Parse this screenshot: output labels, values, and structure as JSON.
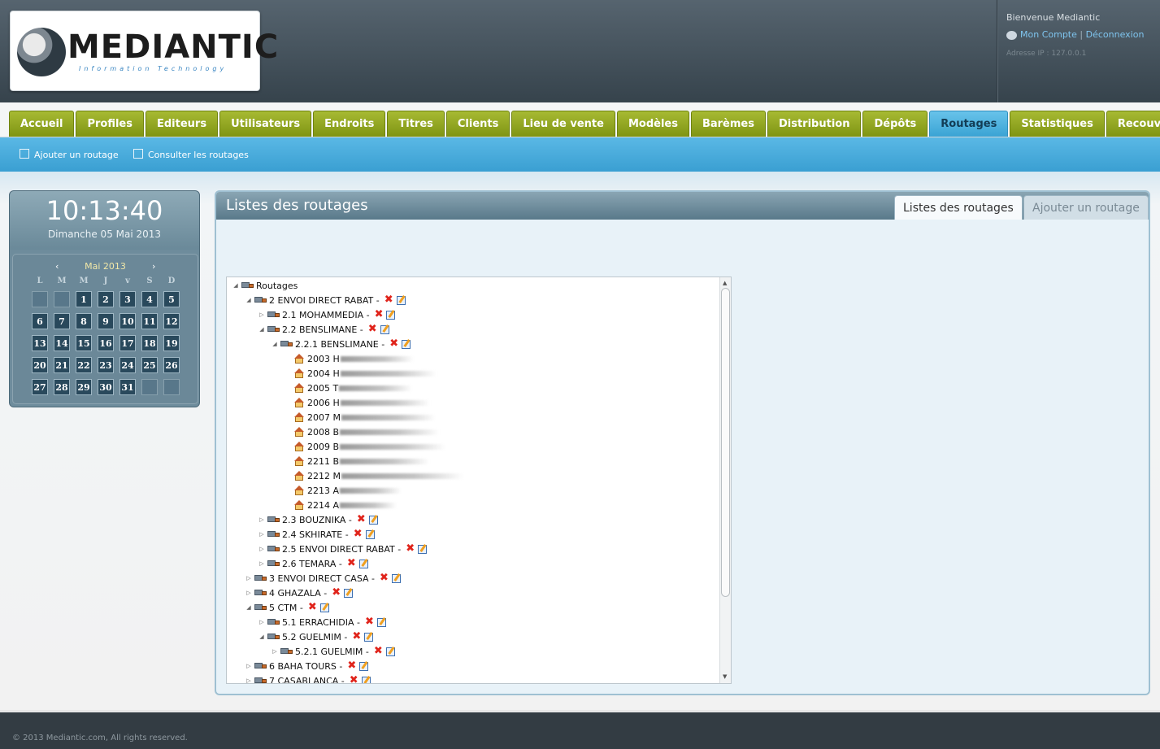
{
  "header": {
    "logo_text": "MEDIANTIC",
    "logo_subtitle": "Information Technology",
    "welcome": "Bienvenue Mediantic",
    "account_link": "Mon Compte",
    "separator": "|",
    "logout_link": "Déconnexion",
    "ip_text": "Adresse IP : 127.0.0.1"
  },
  "nav": {
    "tabs": [
      {
        "label": "Accueil"
      },
      {
        "label": "Profiles"
      },
      {
        "label": "Editeurs"
      },
      {
        "label": "Utilisateurs"
      },
      {
        "label": "Endroits"
      },
      {
        "label": "Titres"
      },
      {
        "label": "Clients"
      },
      {
        "label": "Lieu de vente"
      },
      {
        "label": "Modèles"
      },
      {
        "label": "Barèmes"
      },
      {
        "label": "Distribution"
      },
      {
        "label": "Dépôts"
      },
      {
        "label": "Routages",
        "active": true
      },
      {
        "label": "Statistiques"
      },
      {
        "label": "Recouvrement"
      }
    ],
    "active_tab": "Routages",
    "active_color": "#3aa3d4",
    "tab_color": "#8ca41d"
  },
  "subnav": {
    "add_label": "Ajouter un routage",
    "consult_label": "Consulter les routages"
  },
  "clock": {
    "time": "10:13:40",
    "date": "Dimanche 05 Mai 2013",
    "calendar": {
      "month": "Mai 2013",
      "prev": "‹",
      "next": "›",
      "weekdays": [
        "L",
        "M",
        "M",
        "J",
        "v",
        "S",
        "D"
      ],
      "weeks": [
        [
          "",
          "",
          "1",
          "2",
          "3",
          "4",
          "5"
        ],
        [
          "6",
          "7",
          "8",
          "9",
          "10",
          "11",
          "12"
        ],
        [
          "13",
          "14",
          "15",
          "16",
          "17",
          "18",
          "19"
        ],
        [
          "20",
          "21",
          "22",
          "23",
          "24",
          "25",
          "26"
        ],
        [
          "27",
          "28",
          "29",
          "30",
          "31",
          "",
          ""
        ]
      ]
    }
  },
  "panel": {
    "title": "Listes des routages",
    "tab_list": "Listes des routages",
    "tab_add": "Ajouter un routage"
  },
  "tree": {
    "root": "Routages",
    "nodes": [
      {
        "label": "2 ENVOI DIRECT RABAT -",
        "level": 1,
        "expanded": true,
        "icon": "truck",
        "actions": true
      },
      {
        "label": "2.1 MOHAMMEDIA -",
        "level": 2,
        "expanded": false,
        "icon": "truck",
        "actions": true
      },
      {
        "label": "2.2 BENSLIMANE -",
        "level": 2,
        "expanded": true,
        "icon": "truck",
        "actions": true
      },
      {
        "label": "2.2.1 BENSLIMANE -",
        "level": 3,
        "expanded": true,
        "icon": "truck",
        "actions": true
      },
      {
        "label": "2003 H",
        "level": 4,
        "icon": "house",
        "redacted": true
      },
      {
        "label": "2004 H",
        "level": 4,
        "icon": "house",
        "redacted": true
      },
      {
        "label": "2005 T",
        "level": 4,
        "icon": "house",
        "redacted": true
      },
      {
        "label": "2006 H",
        "level": 4,
        "icon": "house",
        "redacted": true
      },
      {
        "label": "2007 M",
        "level": 4,
        "icon": "house",
        "redacted": true
      },
      {
        "label": "2008 B",
        "level": 4,
        "icon": "house",
        "redacted": true
      },
      {
        "label": "2009 B",
        "level": 4,
        "icon": "house",
        "redacted": true
      },
      {
        "label": "2211 B",
        "level": 4,
        "icon": "house",
        "redacted": true
      },
      {
        "label": "2212 M",
        "level": 4,
        "icon": "house",
        "redacted": true
      },
      {
        "label": "2213 A",
        "level": 4,
        "icon": "house",
        "redacted": true
      },
      {
        "label": "2214 A",
        "level": 4,
        "icon": "house",
        "redacted": true
      },
      {
        "label": "2.3 BOUZNIKA -",
        "level": 2,
        "expanded": false,
        "icon": "truck",
        "actions": true
      },
      {
        "label": "2.4 SKHIRATE -",
        "level": 2,
        "expanded": false,
        "icon": "truck",
        "actions": true
      },
      {
        "label": "2.5 ENVOI DIRECT RABAT -",
        "level": 2,
        "expanded": false,
        "icon": "truck",
        "actions": true
      },
      {
        "label": "2.6 TEMARA -",
        "level": 2,
        "expanded": false,
        "icon": "truck",
        "actions": true
      },
      {
        "label": "3 ENVOI DIRECT CASA -",
        "level": 1,
        "expanded": false,
        "icon": "truck",
        "actions": true
      },
      {
        "label": "4 GHAZALA -",
        "level": 1,
        "expanded": false,
        "icon": "truck",
        "actions": true
      },
      {
        "label": "5 CTM -",
        "level": 1,
        "expanded": true,
        "icon": "truck",
        "actions": true
      },
      {
        "label": "5.1 ERRACHIDIA -",
        "level": 2,
        "expanded": false,
        "icon": "truck",
        "actions": true
      },
      {
        "label": "5.2 GUELMIM -",
        "level": 2,
        "expanded": true,
        "icon": "truck",
        "actions": true
      },
      {
        "label": "5.2.1 GUELMIM -",
        "level": 3,
        "expanded": false,
        "icon": "truck",
        "actions": true
      },
      {
        "label": "6 BAHA TOURS -",
        "level": 1,
        "expanded": false,
        "icon": "truck",
        "actions": true
      },
      {
        "label": "7 CASABLANCA -",
        "level": 1,
        "expanded": false,
        "icon": "truck",
        "actions": true
      }
    ],
    "delete_icon": "delete-x-icon",
    "edit_icon": "edit-note-icon"
  },
  "footer": {
    "copyright": "© 2013 Mediantic.com, All rights reserved."
  }
}
